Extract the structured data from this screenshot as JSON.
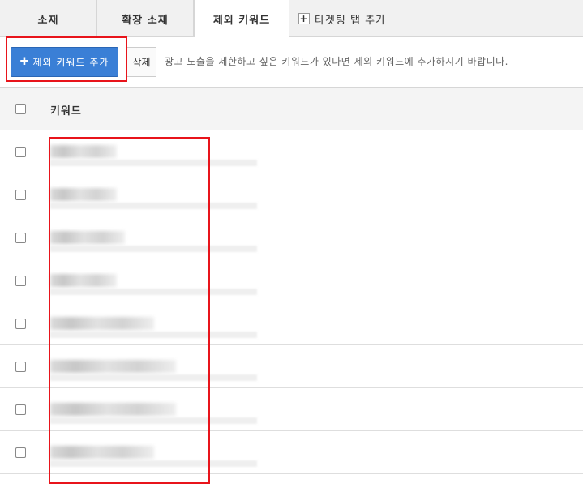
{
  "tabs": [
    {
      "label": "소재"
    },
    {
      "label": "확장 소재"
    },
    {
      "label": "제외 키워드",
      "active": true
    }
  ],
  "add_tab": {
    "label": "타겟팅 탭 추가",
    "icon": "plus-box-icon"
  },
  "toolbar": {
    "add_button_label": "제외 키워드 추가",
    "add_button_icon": "plus-icon",
    "delete_button_label": "삭제",
    "hint": "광고 노출을 제한하고 싶은 키워드가 있다면 제외 키워드에 추가하시기 바랍니다."
  },
  "table": {
    "header": {
      "keyword_label": "키워드"
    },
    "rows_visible": 8
  },
  "colors": {
    "accent": "#3a7fd6",
    "highlight_annotation": "#e8141b"
  }
}
